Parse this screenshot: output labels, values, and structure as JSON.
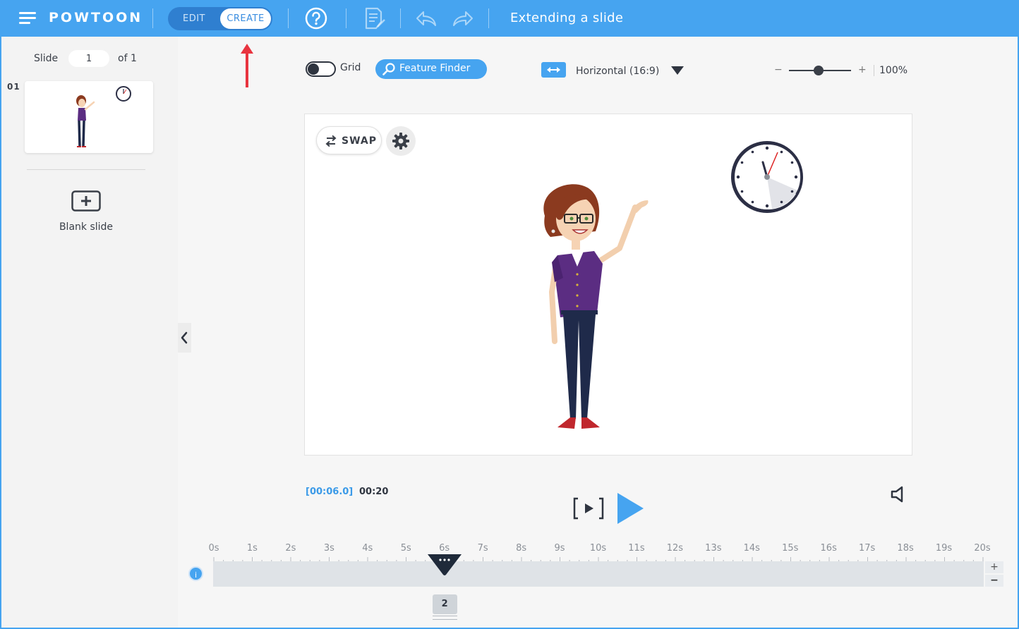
{
  "app": {
    "logo": "POWTOON",
    "mode_edit": "EDIT",
    "mode_create": "CREATE",
    "slide_title": "Extending a slide",
    "accent_color": "#46a4f0",
    "icons": {
      "menu": "hamburger-menu-icon",
      "help": "help-circle-icon",
      "notes": "notes-icon",
      "undo": "undo-icon",
      "redo": "redo-icon"
    }
  },
  "sidebar": {
    "slide_label": "Slide",
    "slide_input_value": "1",
    "of_label": "of 1",
    "slides": [
      {
        "number": "01"
      }
    ],
    "blank_slide_label": "Blank slide"
  },
  "toolbar": {
    "grid_label": "Grid",
    "grid_enabled": false,
    "feature_finder_label": "Feature Finder",
    "aspect_label": "Horizontal (16:9)",
    "zoom_minus": "−",
    "zoom_plus": "+",
    "zoom_level": 1.0,
    "zoom_value": "100%"
  },
  "canvas": {
    "swap_label": "SWAP"
  },
  "playback": {
    "current_time": "[00:06.0]",
    "total_time": "00:20"
  },
  "timeline": {
    "ticks": [
      "0s",
      "1s",
      "2s",
      "3s",
      "4s",
      "5s",
      "6s",
      "7s",
      "8s",
      "9s",
      "10s",
      "11s",
      "12s",
      "13s",
      "14s",
      "15s",
      "16s",
      "17s",
      "18s",
      "19s",
      "20s"
    ],
    "info_label": "i",
    "zoom_plus": "+",
    "zoom_minus": "−",
    "playhead_seconds": 6,
    "total_seconds": 20,
    "slide_marker": "2"
  }
}
